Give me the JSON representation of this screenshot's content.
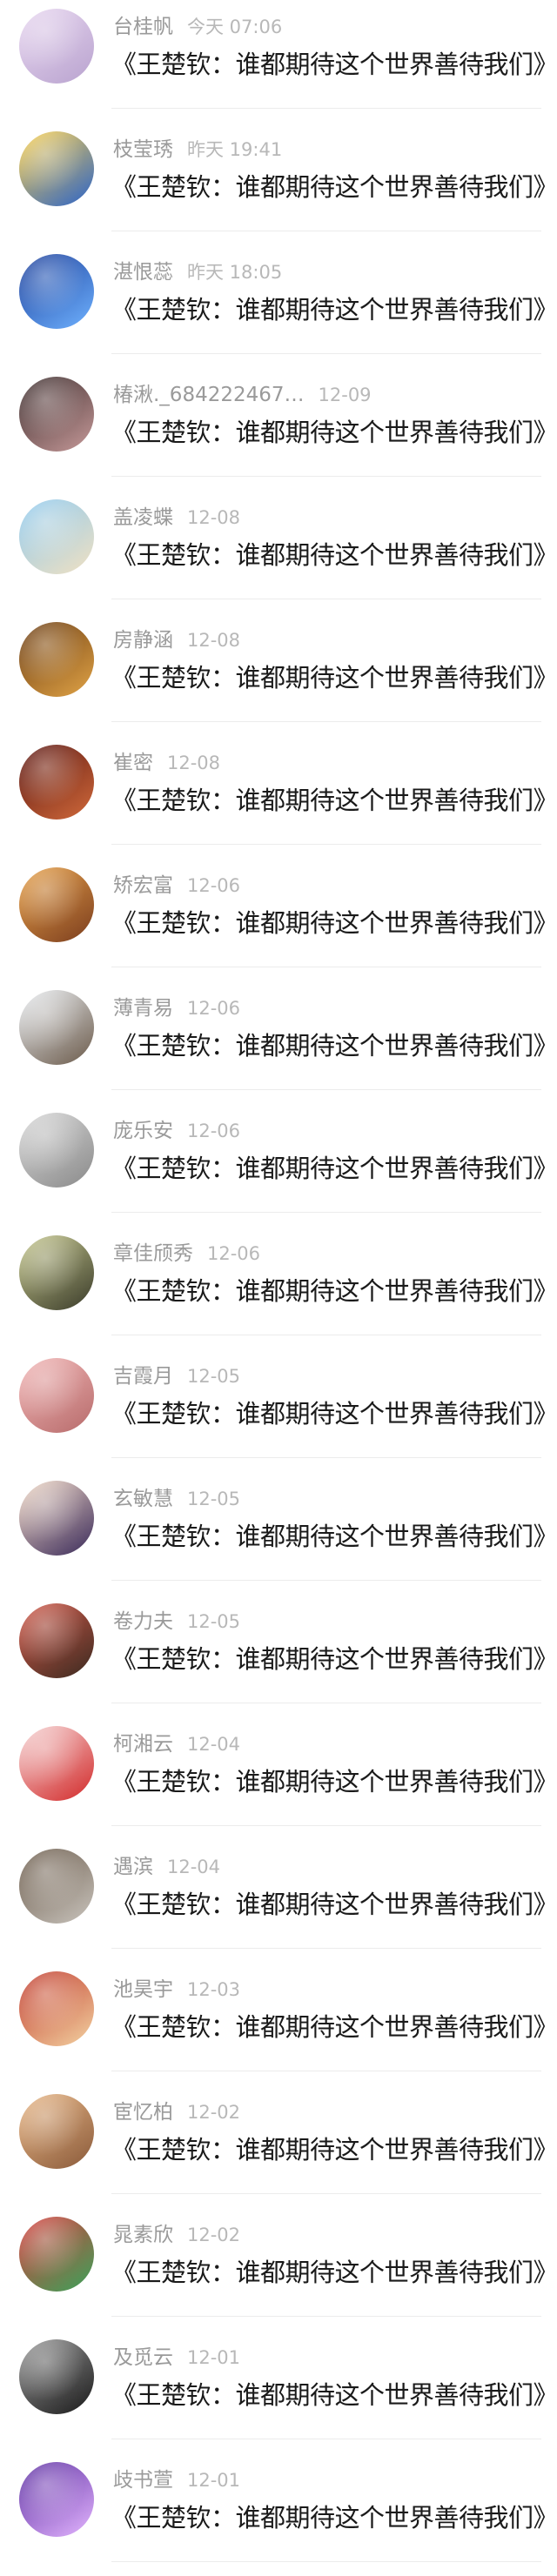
{
  "comments": [
    {
      "username": "台桂帆",
      "time": "今天 07:06",
      "message": "《王楚钦：谁都期待这个世界善待我们》",
      "avatar_colors": [
        "#e8d7f0",
        "#b9a3cf"
      ]
    },
    {
      "username": "枝莹琇",
      "time": "昨天 19:41",
      "message": "《王楚钦：谁都期待这个世界善待我们》",
      "avatar_colors": [
        "#ffd24a",
        "#2a63c9"
      ]
    },
    {
      "username": "湛恨蕊",
      "time": "昨天 18:05",
      "message": "《王楚钦：谁都期待这个世界善待我们》",
      "avatar_colors": [
        "#1b3e9a",
        "#6fb2ff"
      ]
    },
    {
      "username": "椿湫._684222467…",
      "time": "12-09",
      "message": "《王楚钦：谁都期待这个世界善待我们》",
      "avatar_colors": [
        "#3a2b2b",
        "#c79a9a"
      ]
    },
    {
      "username": "盖凌蝶",
      "time": "12-08",
      "message": "《王楚钦：谁都期待这个世界善待我们》",
      "avatar_colors": [
        "#8ec9ee",
        "#f1e1c2"
      ]
    },
    {
      "username": "房静涵",
      "time": "12-08",
      "message": "《王楚钦：谁都期待这个世界善待我们》",
      "avatar_colors": [
        "#6a3b11",
        "#e1a447"
      ]
    },
    {
      "username": "崔密",
      "time": "12-08",
      "message": "《王楚钦：谁都期待这个世界善待我们》",
      "avatar_colors": [
        "#5a1510",
        "#d16a3b"
      ]
    },
    {
      "username": "矫宏富",
      "time": "12-06",
      "message": "《王楚钦：谁都期待这个世界善待我们》",
      "avatar_colors": [
        "#e8a24a",
        "#7b3d1e"
      ]
    },
    {
      "username": "薄青易",
      "time": "12-06",
      "message": "《王楚钦：谁都期待这个世界善待我们》",
      "avatar_colors": [
        "#eaeef2",
        "#6b5a4a"
      ]
    },
    {
      "username": "庞乐安",
      "time": "12-06",
      "message": "《王楚钦：谁都期待这个世界善待我们》",
      "avatar_colors": [
        "#d8d8d8",
        "#8a8a8a"
      ]
    },
    {
      "username": "章佳颀秀",
      "time": "12-06",
      "message": "《王楚钦：谁都期待这个世界善待我们》",
      "avatar_colors": [
        "#c7c98f",
        "#3a3b2a"
      ]
    },
    {
      "username": "吉霞月",
      "time": "12-05",
      "message": "《王楚钦：谁都期待这个世界善待我们》",
      "avatar_colors": [
        "#f2b7b7",
        "#b76b6b"
      ]
    },
    {
      "username": "玄敏慧",
      "time": "12-05",
      "message": "《王楚钦：谁都期待这个世界善待我们》",
      "avatar_colors": [
        "#f4dcc8",
        "#3a2a5a"
      ]
    },
    {
      "username": "卷力夫",
      "time": "12-05",
      "message": "《王楚钦：谁都期待这个世界善待我们》",
      "avatar_colors": [
        "#d45a4a",
        "#3a2a20"
      ]
    },
    {
      "username": "柯湘云",
      "time": "12-04",
      "message": "《王楚钦：谁都期待这个世界善待我们》",
      "avatar_colors": [
        "#f6d6d6",
        "#d22a2a"
      ]
    },
    {
      "username": "遇滨",
      "time": "12-04",
      "message": "《王楚钦：谁都期待这个世界善待我们》",
      "avatar_colors": [
        "#6a5a4a",
        "#c9c4bd"
      ]
    },
    {
      "username": "池昊宇",
      "time": "12-03",
      "message": "《王楚钦：谁都期待这个世界善待我们》",
      "avatar_colors": [
        "#c0392b",
        "#f3d3a2"
      ]
    },
    {
      "username": "宦忆柏",
      "time": "12-02",
      "message": "《王楚钦：谁都期待这个世界善待我们》",
      "avatar_colors": [
        "#e9b888",
        "#8a5a3a"
      ]
    },
    {
      "username": "晁素欣",
      "time": "12-02",
      "message": "《王楚钦：谁都期待这个世界善待我们》",
      "avatar_colors": [
        "#d83a3a",
        "#3aa35a"
      ]
    },
    {
      "username": "及觅云",
      "time": "12-01",
      "message": "《王楚钦：谁都期待这个世界善待我们》",
      "avatar_colors": [
        "#9a9a9a",
        "#1a1a1a"
      ]
    },
    {
      "username": "歧书萱",
      "time": "12-01",
      "message": "《王楚钦：谁都期待这个世界善待我们》",
      "avatar_colors": [
        "#5a2ca0",
        "#e4b6ff"
      ]
    }
  ]
}
